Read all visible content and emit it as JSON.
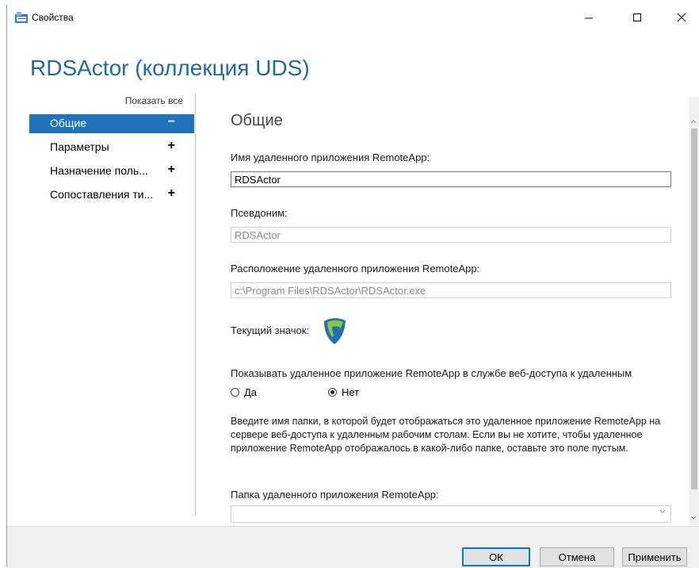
{
  "window": {
    "title": "Свойства",
    "minimize": "—",
    "maximize": "☐",
    "close": "✕"
  },
  "header": "RDSActor (коллекция UDS)",
  "nav": {
    "show_all": "Показать все",
    "items": [
      {
        "label": "Общие",
        "toggle": "−",
        "selected": true
      },
      {
        "label": "Параметры",
        "toggle": "+"
      },
      {
        "label": "Назначение поль...",
        "toggle": "+"
      },
      {
        "label": "Сопоставления ти...",
        "toggle": "+"
      }
    ]
  },
  "general": {
    "title": "Общие",
    "name_label": "Имя удаленного приложения RemoteApp:",
    "name_value": "RDSActor",
    "alias_label": "Псевдоним:",
    "alias_value": "RDSActor",
    "location_label": "Расположение удаленного приложения RemoteApp:",
    "location_value": "c:\\Program Files\\RDSActor\\RDSActor.exe",
    "icon_label": "Текущий значок:",
    "show_label": "Показывать удаленное приложение RemoteApp в службе веб-доступа к удаленным",
    "radio_yes": "Да",
    "radio_no": "Нет",
    "radio_selected": "no",
    "folder_description": "Введите имя папки, в которой будет отображаться это удаленное приложение RemoteApp на сервере веб-доступа к удаленным рабочим столам. Если вы не хотите, чтобы удаленное приложение RemoteApp отображалось в какой-либо папке, оставьте это поле пустым.",
    "folder_label": "Папка удаленного приложения RemoteApp:",
    "folder_value": ""
  },
  "buttons": {
    "ok": "ОК",
    "cancel": "Отмена",
    "apply": "Применить"
  },
  "colors": {
    "accent": "#1f73bb",
    "header": "#1e6aa8",
    "icon_green": "#8cc63f",
    "icon_blue": "#1f6fb5"
  }
}
